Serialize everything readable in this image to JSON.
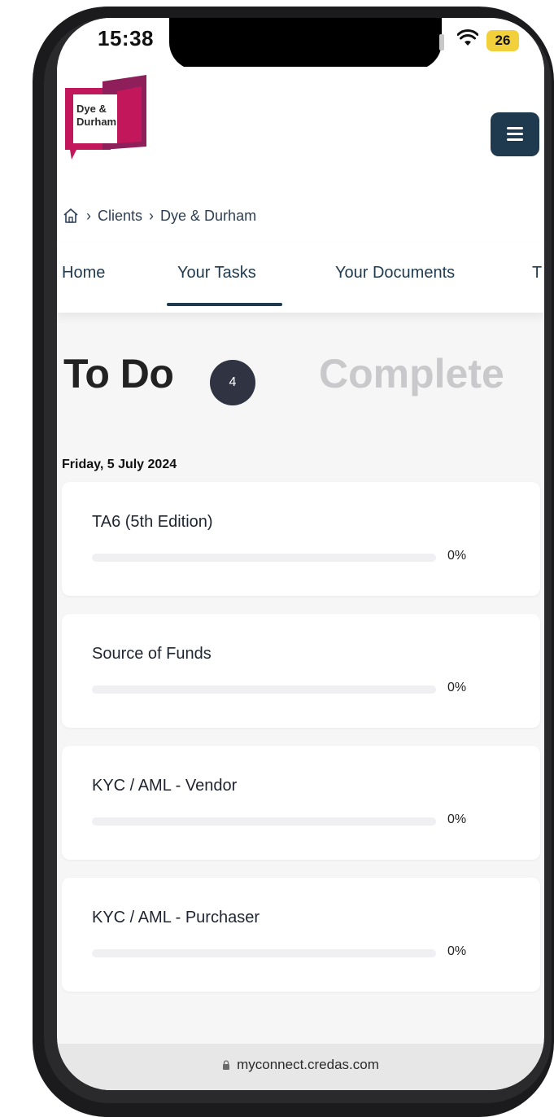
{
  "status_bar": {
    "time": "15:38",
    "battery": "26"
  },
  "header": {
    "logo_line1": "Dye &",
    "logo_line2": "Durham",
    "brand_color": "#c2185b",
    "accent_color": "#1f3a4f"
  },
  "breadcrumb": {
    "items": [
      "Clients",
      "Dye & Durham"
    ]
  },
  "tabs": [
    {
      "label": "Home"
    },
    {
      "label": "Your Tasks"
    },
    {
      "label": "Your Documents"
    },
    {
      "label": "T"
    }
  ],
  "tasks": {
    "todo_label": "To Do",
    "todo_count": "4",
    "completed_label": "Complete",
    "date": "Friday, 5 July 2024",
    "items": [
      {
        "title": "TA6 (5th Edition)",
        "progress": 0,
        "progress_text": "0%"
      },
      {
        "title": "Source of Funds",
        "progress": 0,
        "progress_text": "0%"
      },
      {
        "title": "KYC / AML - Vendor",
        "progress": 0,
        "progress_text": "0%"
      },
      {
        "title": "KYC / AML - Purchaser",
        "progress": 0,
        "progress_text": "0%"
      }
    ]
  },
  "url_bar": {
    "url": "myconnect.credas.com"
  }
}
